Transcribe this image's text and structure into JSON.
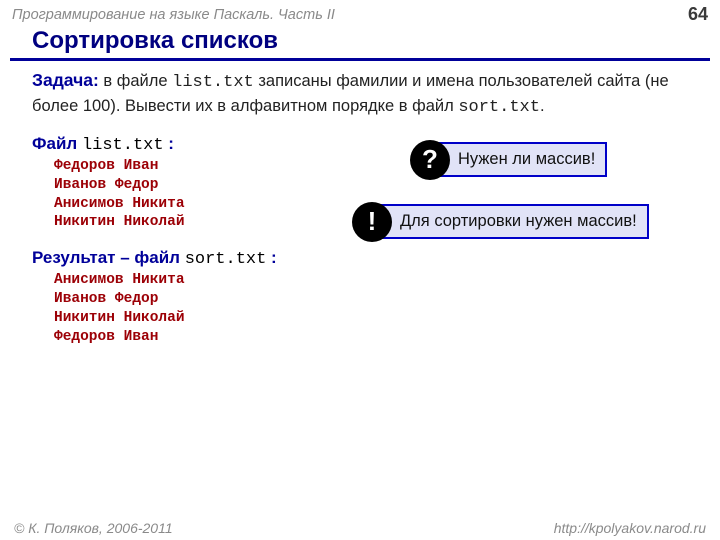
{
  "header": {
    "title": "Программирование на языке Паскаль. Часть II",
    "page": "64"
  },
  "title": "Сортировка списков",
  "task": {
    "label": "Задача:",
    "pre1": " в файле ",
    "file1": "list.txt",
    "mid1": " записаны фамилии и имена пользователей сайта (не более 100). Вывести их в алфавитном порядке в файл ",
    "file2": "sort.txt",
    "end": "."
  },
  "input_section": {
    "label_blue": "Файл ",
    "file": "list.txt",
    "colon": " :",
    "lines": [
      "Федоров Иван",
      "Иванов Федор",
      "Анисимов Никита",
      "Никитин Николай"
    ]
  },
  "output_section": {
    "label_blue": "Результат – файл ",
    "file": "sort.txt",
    "colon": " :",
    "lines": [
      "Анисимов Никита",
      "Иванов Федор",
      "Никитин Николай",
      "Федоров Иван"
    ]
  },
  "callouts": {
    "question": "Нужен ли массив!",
    "answer": "Для сортировки нужен массив!"
  },
  "footer": {
    "left": "© К. Поляков, 2006-2011",
    "right": "http://kpolyakov.narod.ru"
  }
}
